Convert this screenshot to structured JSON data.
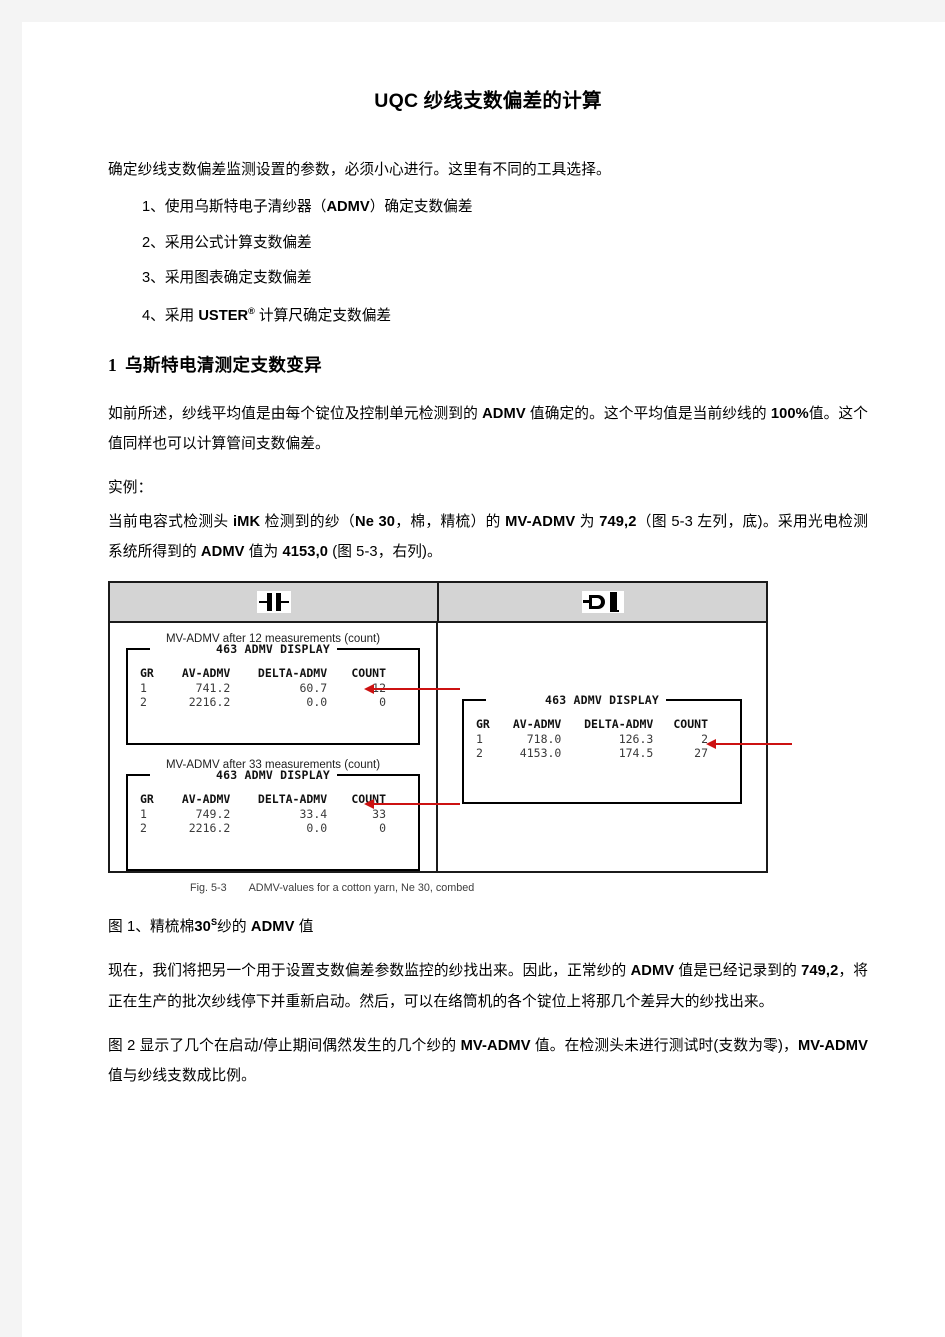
{
  "document": {
    "title_latin": "UQC",
    "title_cn": "纱线支数偏差的计算",
    "intro": "确定纱线支数偏差监测设置的参数，必须小心进行。这里有不同的工具选择。",
    "tool_list": [
      {
        "num": "1、",
        "text_before": "使用乌斯特电子清纱器（",
        "bold": "ADMV",
        "text_after": "）确定支数偏差"
      },
      {
        "num": "2、",
        "text_before": "采用公式计算支数偏差",
        "bold": "",
        "text_after": ""
      },
      {
        "num": "3、",
        "text_before": "采用图表确定支数偏差",
        "bold": "",
        "text_after": ""
      },
      {
        "num": "4、",
        "text_before": "采用 ",
        "bold": "USTER",
        "bold_sup": "®",
        "text_after": " 计算尺确定支数偏差"
      }
    ],
    "section": {
      "number": "1",
      "heading": "乌斯特电清测定支数变异"
    },
    "para1_a": "如前所述，纱线平均值是由每个锭位及控制单元检测到的 ",
    "para1_b": "ADMV",
    "para1_c": " 值确定的。这个平均值是当前纱线的 ",
    "para1_d": "100%",
    "para1_e": "值。这个值同样也可以计算管间支数偏差。",
    "example_label": "实例：",
    "example_a": "当前电容式检测头 ",
    "example_imk": "iMK",
    "example_b": " 检测到的纱（",
    "example_ne": "Ne 30",
    "example_c": "，棉，精梳）的 ",
    "example_mvadmv": "MV-ADMV",
    "example_d": "  为 ",
    "example_value1": "749,2",
    "example_e": "（图 5-3 左列，底)。采用光电检测系统所得到的 ",
    "example_admv": "ADMV",
    "example_f": " 值为 ",
    "example_value2": "4153,0",
    "example_g": " (图 5-3，右列)。",
    "figure_note_a": "图 1、精梳棉",
    "figure_note_30": "30",
    "figure_note_sup": "S",
    "figure_note_b": "纱的 ",
    "figure_note_admv": "ADMV",
    "figure_note_c": " 值",
    "para2_a": "现在，我们将把另一个用于设置支数偏差参数监控的纱找出来。因此，正常纱的  ",
    "para2_admv": "ADMV",
    "para2_b": " 值是已经记录到的 ",
    "para2_value": "749,2",
    "para2_c": "，将正在生产的批次纱线停下并重新启动。然后，可以在络筒机的各个锭位上将那几个差异大的纱找出来。",
    "para3_a": "图 2 显示了几个在启动/停止期间偶然发生的几个纱的 ",
    "para3_mvadmv": "MV-ADMV",
    "para3_b": " 值。在检测头未进行测试时(支数为零)，",
    "para3_mvadmv2": "MV-ADMV",
    "para3_c": " 值与纱线支数成比例。"
  },
  "figure": {
    "header": {
      "left_icon": "capacitive-sensor-icon",
      "right_icon": "optical-sensor-icon"
    },
    "left_panel": {
      "blocks": [
        {
          "caption": "MV-ADMV after 12 measurements (count)",
          "legend": "463 ADMV DISPLAY",
          "columns": [
            "GR",
            "AV-ADMV",
            "DELTA-ADMV",
            "COUNT"
          ],
          "rows": [
            [
              "1",
              "741.2",
              "60.7",
              "12"
            ],
            [
              "2",
              "2216.2",
              "0.0",
              "0"
            ]
          ],
          "arrow_row": 0
        },
        {
          "caption": "MV-ADMV after 33 measurements (count)",
          "legend": "463 ADMV DISPLAY",
          "columns": [
            "GR",
            "AV-ADMV",
            "DELTA-ADMV",
            "COUNT"
          ],
          "rows": [
            [
              "1",
              "749.2",
              "33.4",
              "33"
            ],
            [
              "2",
              "2216.2",
              "0.0",
              "0"
            ]
          ],
          "arrow_row": 0
        }
      ]
    },
    "right_panel": {
      "blocks": [
        {
          "caption": "",
          "legend": "463 ADMV DISPLAY",
          "columns": [
            "GR",
            "AV-ADMV",
            "DELTA-ADMV",
            "COUNT"
          ],
          "rows": [
            [
              "1",
              "718.0",
              "126.3",
              "2"
            ],
            [
              "2",
              "4153.0",
              "174.5",
              "27"
            ]
          ],
          "arrow_row": 1
        }
      ]
    },
    "caption_id": "Fig. 5-3",
    "caption_text": "ADMV-values for a cotton yarn, Ne 30, combed"
  },
  "colors": {
    "arrow_red": "#cc1111",
    "header_gray": "#d4d4d4",
    "border_black": "#1b1b1b",
    "page_margin": "#f4f4f4"
  }
}
